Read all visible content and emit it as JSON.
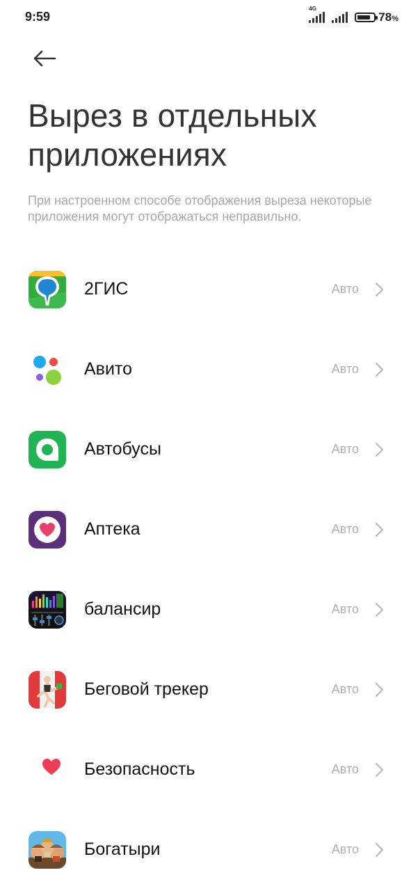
{
  "status_bar": {
    "time": "9:59",
    "network": "4G",
    "battery_percent": "78",
    "battery_unit": "%",
    "battery_level": 0.78
  },
  "header": {
    "back_icon": "arrow-left-icon",
    "title": "Вырез в отдельных приложениях",
    "description": "При настроенном способе отображения выреза некоторые приложения могут отображаться неправильно."
  },
  "apps": [
    {
      "name": "2ГИС",
      "value": "Авто",
      "icon": "2gis-icon"
    },
    {
      "name": "Авито",
      "value": "Авто",
      "icon": "avito-icon"
    },
    {
      "name": "Автобусы",
      "value": "Авто",
      "icon": "buses-icon"
    },
    {
      "name": "Аптека",
      "value": "Авто",
      "icon": "pharmacy-icon"
    },
    {
      "name": "балансир",
      "value": "Авто",
      "icon": "equalizer-icon"
    },
    {
      "name": "Беговой трекер",
      "value": "Авто",
      "icon": "running-tracker-icon"
    },
    {
      "name": "Безопасность",
      "value": "Авто",
      "icon": "security-heart-icon"
    },
    {
      "name": "Богатыри",
      "value": "Авто",
      "icon": "bogatyri-game-icon"
    }
  ],
  "colors": {
    "title": "#333333",
    "description": "#a8a8a8",
    "value": "#b0b0b0",
    "chevron": "#b8b8b8"
  }
}
